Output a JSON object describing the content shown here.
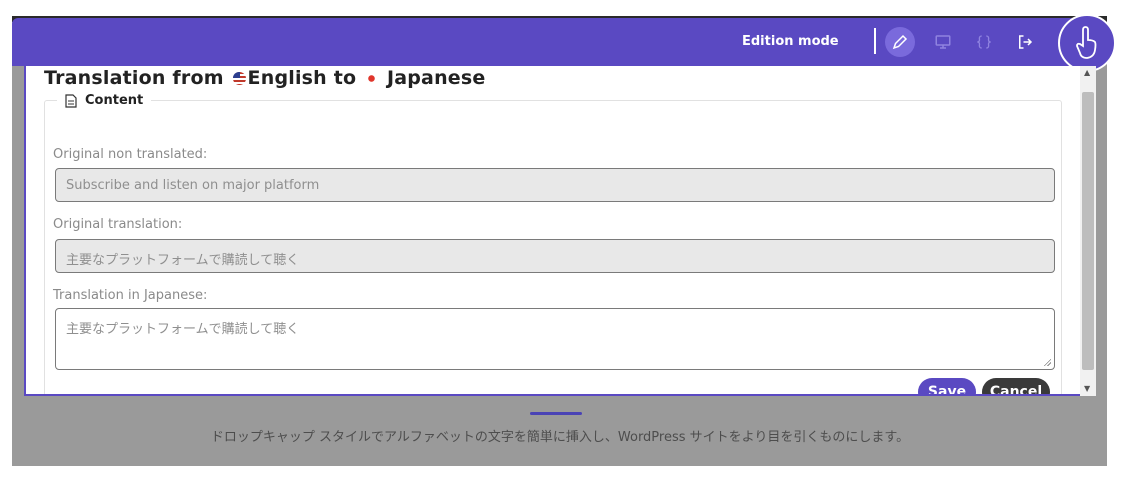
{
  "header": {
    "mode_label": "Edition mode",
    "icons": [
      "pencil-icon",
      "monitor-icon",
      "code-braces-icon",
      "logout-icon",
      "hand-pointer-icon"
    ],
    "accent_color": "#5a49c2"
  },
  "dialog": {
    "title_prefix": "Translation from",
    "source_lang": "English",
    "title_mid": "to",
    "target_lang": "Japanese",
    "section_label": "Content",
    "fields": {
      "original_label": "Original non translated:",
      "original_value": "Subscribe and listen on major platform",
      "orig_trans_label": "Original translation:",
      "orig_trans_value": "主要なプラットフォームで購読して聴く",
      "translation_label": "Translation in Japanese:",
      "translation_value": "主要なプラットフォームで購読して聴く"
    },
    "buttons": {
      "save": "Save",
      "cancel": "Cancel"
    }
  },
  "background": {
    "text": "ドロップキャップ スタイルでアルファベットの文字を簡単に挿入し、WordPress サイトをより目を引くものにします。"
  }
}
